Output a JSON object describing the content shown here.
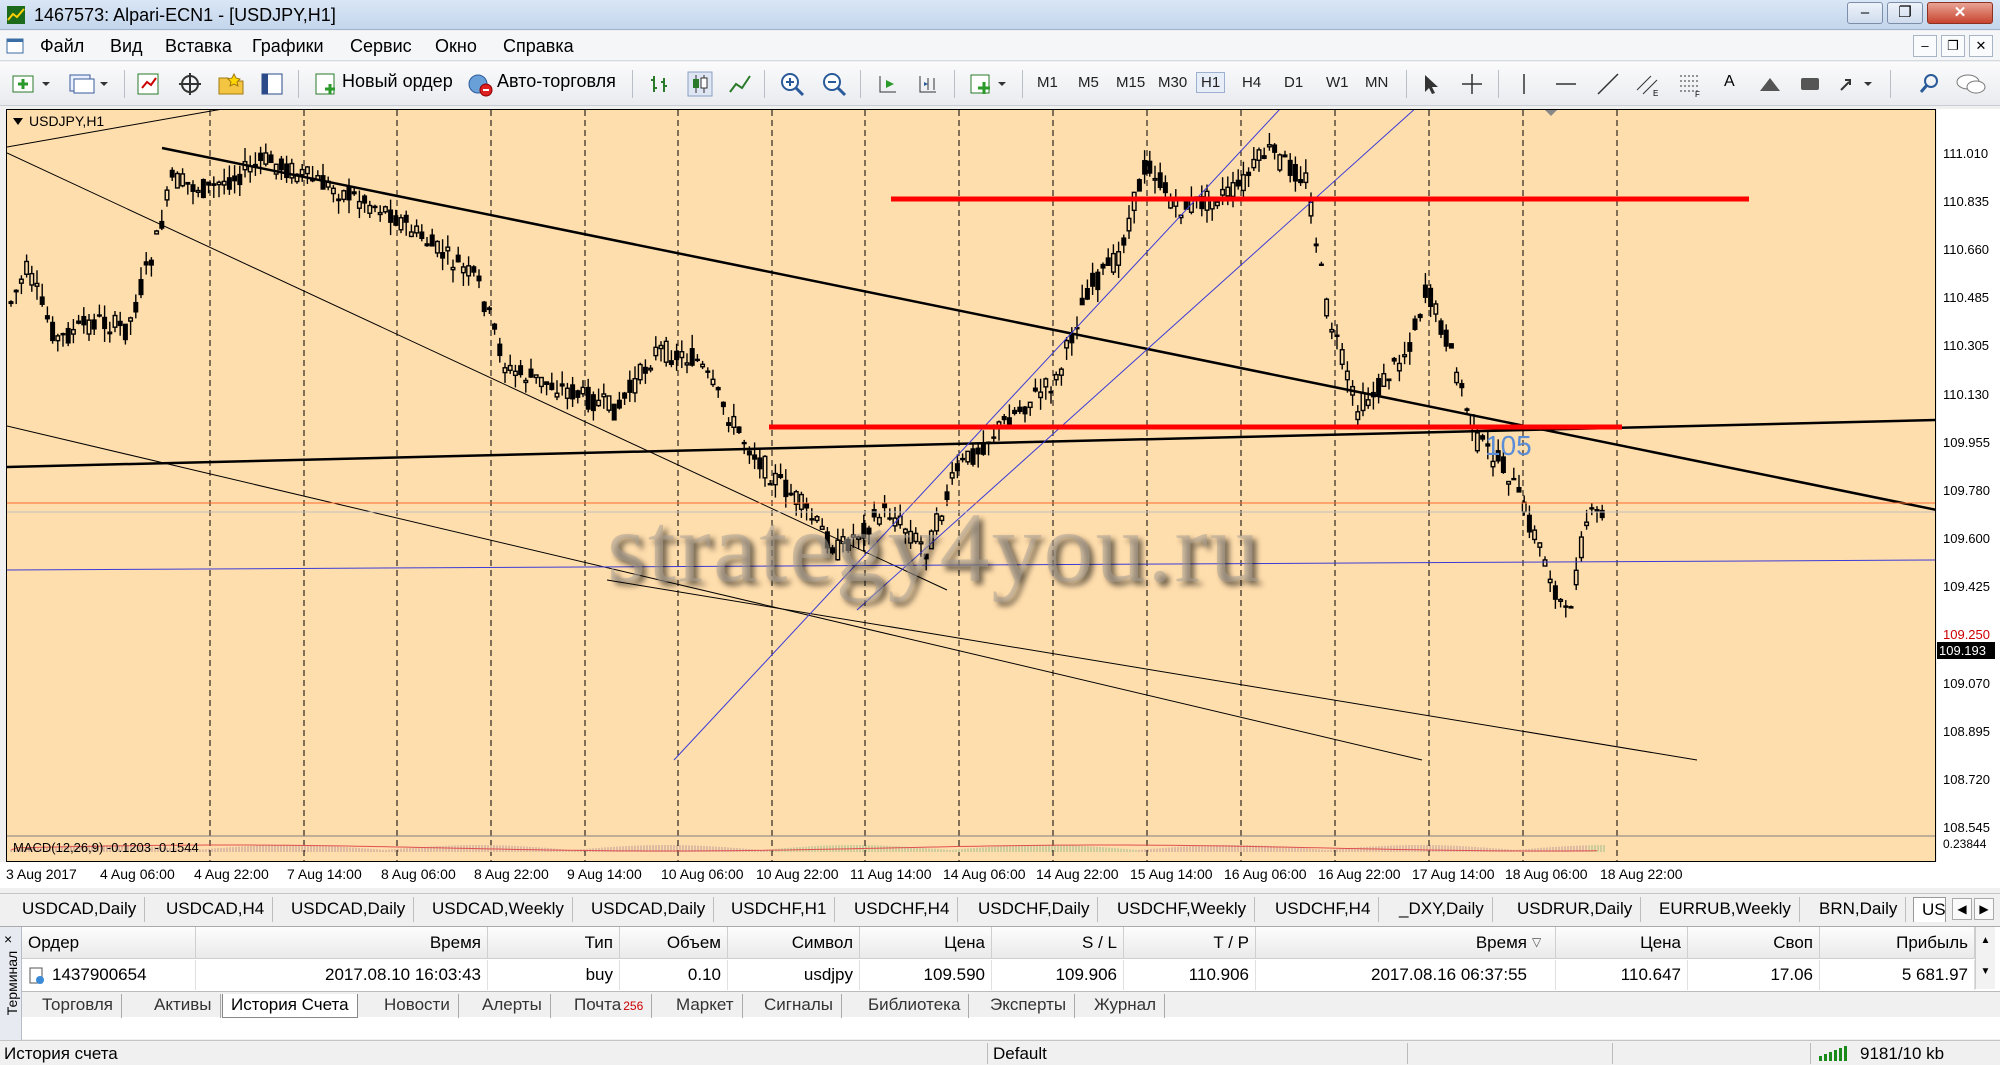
{
  "window": {
    "title": "1467573: Alpari-ECN1 - [USDJPY,H1]",
    "minimize": "–",
    "restore": "❐",
    "close": "✕"
  },
  "menu": {
    "items": [
      "Файл",
      "Вид",
      "Вставка",
      "Графики",
      "Сервис",
      "Окно",
      "Справка"
    ],
    "mdi_minimize": "–",
    "mdi_restore": "❐",
    "mdi_close": "✕"
  },
  "toolbar": {
    "new_order": "Новый ордер",
    "auto_trading": "Авто-торговля",
    "timeframes": [
      "M1",
      "M5",
      "M15",
      "M30",
      "H1",
      "H4",
      "D1",
      "W1",
      "MN"
    ],
    "active_timeframe": "H1",
    "text_tool": "A"
  },
  "chart": {
    "symbol_label": "USDJPY,H1",
    "macd_label": "MACD(12,26,9) -0.1203 -0.1544",
    "annotation": "105",
    "watermark": "strategy4you.ru",
    "price_labels": [
      "111.010",
      "110.835",
      "110.660",
      "110.485",
      "110.305",
      "110.130",
      "109.955",
      "109.780",
      "109.600",
      "109.425",
      "109.250",
      "109.070",
      "108.895",
      "108.720",
      "108.545"
    ],
    "current_price": "109.193",
    "macd_axis_label": "0.23844",
    "time_labels": [
      "3 Aug 2017",
      "4 Aug 06:00",
      "4 Aug 22:00",
      "7 Aug 14:00",
      "8 Aug 06:00",
      "8 Aug 22:00",
      "9 Aug 14:00",
      "10 Aug 06:00",
      "10 Aug 22:00",
      "11 Aug 14:00",
      "14 Aug 06:00",
      "14 Aug 22:00",
      "15 Aug 14:00",
      "16 Aug 06:00",
      "16 Aug 22:00",
      "17 Aug 14:00",
      "18 Aug 06:00",
      "18 Aug 22:00"
    ]
  },
  "symbol_tabs": [
    "USDCAD,Daily",
    "USDCAD,H4",
    "USDCAD,Daily",
    "USDCAD,Weekly",
    "USDCAD,Daily",
    "USDCHF,H1",
    "USDCHF,H4",
    "USDCHF,Daily",
    "USDCHF,Weekly",
    "USDCHF,H4",
    "_DXY,Daily",
    "USDRUR,Daily",
    "EURRUB,Weekly",
    "BRN,Daily",
    "US"
  ],
  "terminal": {
    "side_label": "Терминал",
    "close": "×",
    "columns": [
      "Ордер",
      "Время",
      "Тип",
      "Объем",
      "Символ",
      "Цена",
      "S / L",
      "T / P",
      "Время",
      "Цена",
      "Своп",
      "Прибыль"
    ],
    "sort_marker": "▽",
    "rows": [
      {
        "order": "1437900654",
        "open_time": "2017.08.10 16:03:43",
        "type": "buy",
        "volume": "0.10",
        "symbol": "usdjpy",
        "open_price": "109.590",
        "sl": "109.906",
        "tp": "110.906",
        "close_time": "2017.08.16 06:37:55",
        "close_price": "110.647",
        "swap": "17.06",
        "profit": "5 681.97"
      }
    ],
    "tabs": [
      "Торговля",
      "Активы",
      "История Счета",
      "Новости",
      "Алерты",
      "Почта",
      "Маркет",
      "Сигналы",
      "Библиотека",
      "Эксперты",
      "Журнал"
    ],
    "active_tab": "История Счета",
    "mail_badge": "256"
  },
  "status": {
    "left": "История счета",
    "profile": "Default",
    "connection": "9181/10 kb"
  }
}
